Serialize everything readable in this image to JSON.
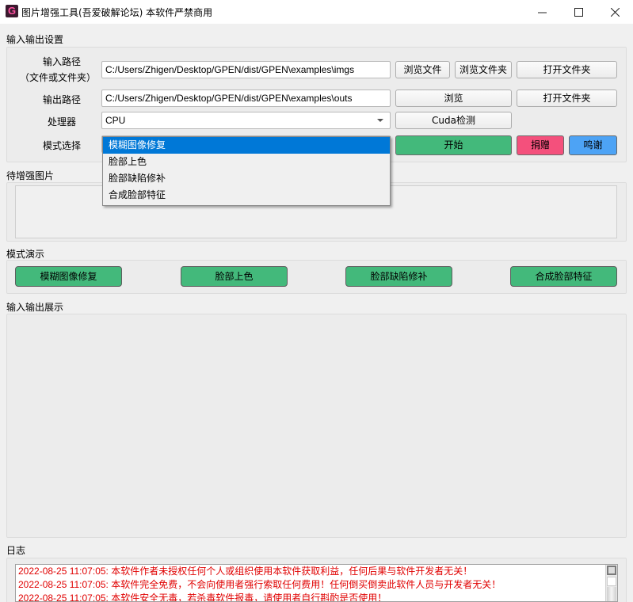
{
  "window": {
    "title": "图片增强工具(吾爱破解论坛) 本软件严禁商用",
    "icon": "app-logo-icon",
    "icon_letter": "G",
    "controls": {
      "minimize": "—",
      "maximize": "☐",
      "close": "✕"
    }
  },
  "io_settings": {
    "section_label": "输入输出设置",
    "input_path": {
      "label": "输入路径",
      "sublabel": "（文件或文件夹）",
      "value": "C:/Users/Zhigen/Desktop/GPEN/dist/GPEN\\examples\\imgs",
      "browse_file_label": "浏览文件",
      "browse_folder_label": "浏览文件夹",
      "open_folder_label": "打开文件夹"
    },
    "output_path": {
      "label": "输出路径",
      "value": "C:/Users/Zhigen/Desktop/GPEN/dist/GPEN\\examples\\outs",
      "browse_label": "浏览",
      "open_folder_label": "打开文件夹"
    },
    "processor": {
      "label": "处理器",
      "selected": "CPU",
      "cuda_check_label": "Cuda检测"
    },
    "mode": {
      "label": "模式选择",
      "selected": "模糊图像修复",
      "options": [
        "模糊图像修复",
        "脸部上色",
        "脸部缺陷修补",
        "合成脸部特征"
      ],
      "start_label": "开始",
      "donate_label": "捐赠",
      "thanks_label": "鸣谢"
    }
  },
  "pending_images": {
    "section_label": "待增强图片"
  },
  "mode_demo": {
    "section_label": "模式演示",
    "buttons": [
      "模糊图像修复",
      "脸部上色",
      "脸部缺陷修补",
      "合成脸部特征"
    ]
  },
  "io_display": {
    "section_label": "输入输出展示"
  },
  "log": {
    "section_label": "日志",
    "lines": [
      "2022-08-25 11:07:05: 本软件作者未授权任何个人或组织使用本软件获取利益，任何后果与软件开发者无关！",
      "2022-08-25 11:07:05: 本软件完全免费，不会向使用者强行索取任何费用！任何倒买倒卖此软件人员与开发者无关！",
      "2022-08-25 11:07:05: 本软件安全无毒，若杀毒软件报毒，请使用者自行斟酌是否使用！"
    ]
  },
  "colors": {
    "start_button": "#43b97b",
    "donate_button": "#f4507c",
    "thanks_button": "#4da3f5",
    "dropdown_selected": "#0078d7",
    "log_text": "#e00000"
  }
}
